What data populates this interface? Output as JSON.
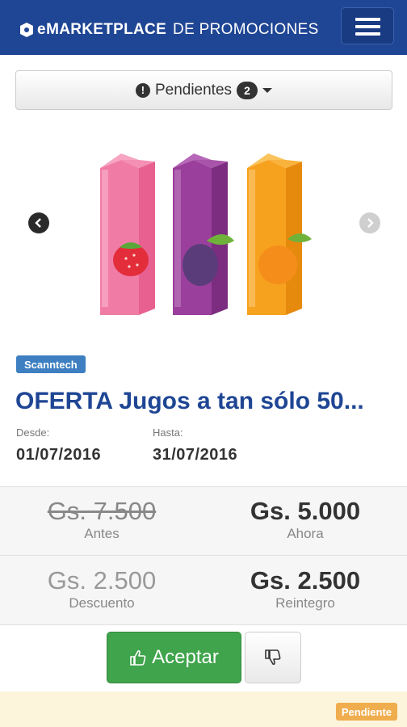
{
  "header": {
    "brand_bold": "MARKETPLACE",
    "brand_e": "e",
    "brand_sub": "DE PROMOCIONES",
    "logo_icon": "ticket-logo-icon",
    "menu_icon": "hamburger-menu-icon"
  },
  "filter": {
    "label": "Pendientes",
    "count": "2",
    "icon": "exclamation-circle-icon",
    "caret_icon": "caret-down-icon"
  },
  "carousel": {
    "prev_icon": "chevron-left-icon",
    "next_icon": "chevron-right-icon",
    "image": "juice-cartons-strawberry-plum-orange"
  },
  "promo": {
    "tag": "Scanntech",
    "title": "OFERTA Jugos a tan sólo 50...",
    "from_label": "Desde:",
    "from_date": "01/07/2016",
    "to_label": "Hasta:",
    "to_date": "31/07/2016"
  },
  "prices": {
    "before_value": "Gs. 7.500",
    "before_label": "Antes",
    "now_value": "Gs. 5.000",
    "now_label": "Ahora",
    "discount_value": "Gs. 2.500",
    "discount_label": "Descuento",
    "refund_value": "Gs. 2.500",
    "refund_label": "Reintegro"
  },
  "actions": {
    "accept_label": "Aceptar",
    "accept_icon": "thumbs-up-icon",
    "reject_icon": "thumbs-down-icon"
  },
  "status": {
    "label": "Pendiente"
  },
  "colors": {
    "navbar": "#1f4694",
    "title": "#1f4694",
    "accept": "#3fa44b",
    "tag": "#3d7fc1",
    "status_badge": "#f0ad4e",
    "footer_bg": "#fcf5db"
  }
}
